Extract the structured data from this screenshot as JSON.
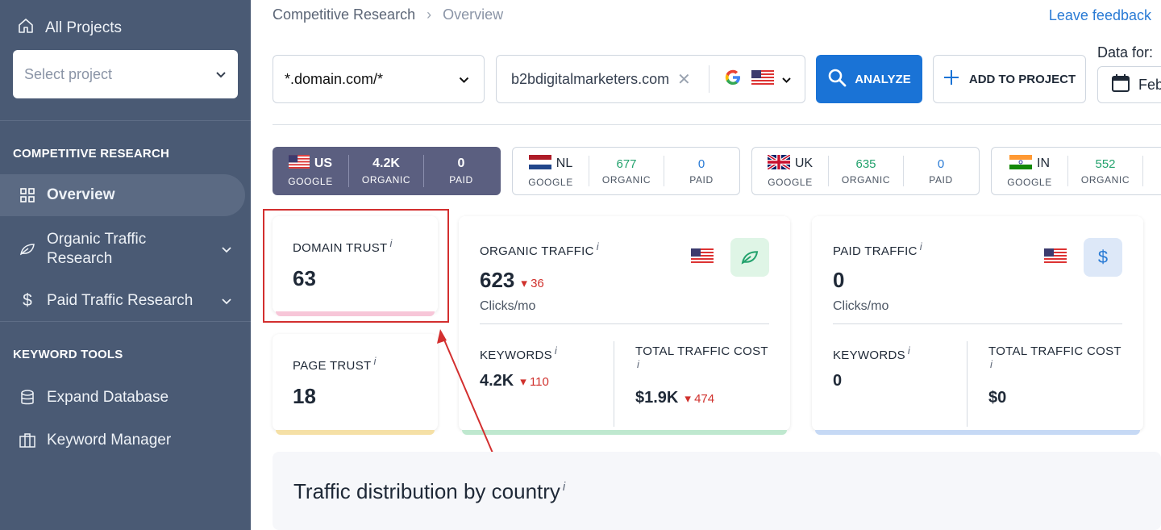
{
  "sidebar": {
    "all_projects": "All Projects",
    "select_placeholder": "Select project",
    "section_competitive": "COMPETITIVE RESEARCH",
    "overview": "Overview",
    "organic_traffic_1": "Organic Traffic",
    "organic_traffic_2": "Research",
    "paid_traffic": "Paid Traffic Research",
    "section_keyword": "KEYWORD TOOLS",
    "expand_database": "Expand Database",
    "keyword_manager": "Keyword Manager"
  },
  "breadcrumb": {
    "parent": "Competitive Research",
    "separator": "›",
    "current": "Overview"
  },
  "header": {
    "feedback": "Leave feedback"
  },
  "search": {
    "domain_mode": "*.domain.com/*",
    "query": "b2bdigitalmarketers.com",
    "analyze": "ANALYZE",
    "add_to_project": "ADD TO PROJECT",
    "data_for_label": "Data for:",
    "date": "Feb"
  },
  "countries": [
    {
      "code": "US",
      "engine": "GOOGLE",
      "organic": "4.2K",
      "organic_label": "ORGANIC",
      "paid": "0",
      "paid_label": "PAID"
    },
    {
      "code": "NL",
      "engine": "GOOGLE",
      "organic": "677",
      "organic_label": "ORGANIC",
      "paid": "0",
      "paid_label": "PAID"
    },
    {
      "code": "UK",
      "engine": "GOOGLE",
      "organic": "635",
      "organic_label": "ORGANIC",
      "paid": "0",
      "paid_label": "PAID"
    },
    {
      "code": "IN",
      "engine": "GOOGLE",
      "organic": "552",
      "organic_label": "ORGANIC"
    }
  ],
  "domain_trust": {
    "label": "DOMAIN TRUST",
    "value": "63"
  },
  "page_trust": {
    "label": "PAGE TRUST",
    "value": "18"
  },
  "organic": {
    "label": "ORGANIC TRAFFIC",
    "value": "623",
    "delta": "36",
    "unit": "Clicks/mo",
    "keywords_label": "KEYWORDS",
    "keywords": "4.2K",
    "keywords_delta": "110",
    "cost_label": "TOTAL TRAFFIC COST",
    "cost": "$1.9K",
    "cost_delta": "474"
  },
  "paid": {
    "label": "PAID TRAFFIC",
    "value": "0",
    "unit": "Clicks/mo",
    "keywords_label": "KEYWORDS",
    "keywords": "0",
    "cost_label": "TOTAL TRAFFIC COST",
    "cost": "$0"
  },
  "distribution": {
    "title": "Traffic distribution by country"
  },
  "info_mark": "i",
  "colors": {
    "sidebar": "#4a5a74",
    "accent": "#1a73d6",
    "active_tab": "#5b5f80",
    "organic_green": "#23a26d",
    "decline_red": "#d0312d",
    "annotation": "#d32f2f"
  }
}
